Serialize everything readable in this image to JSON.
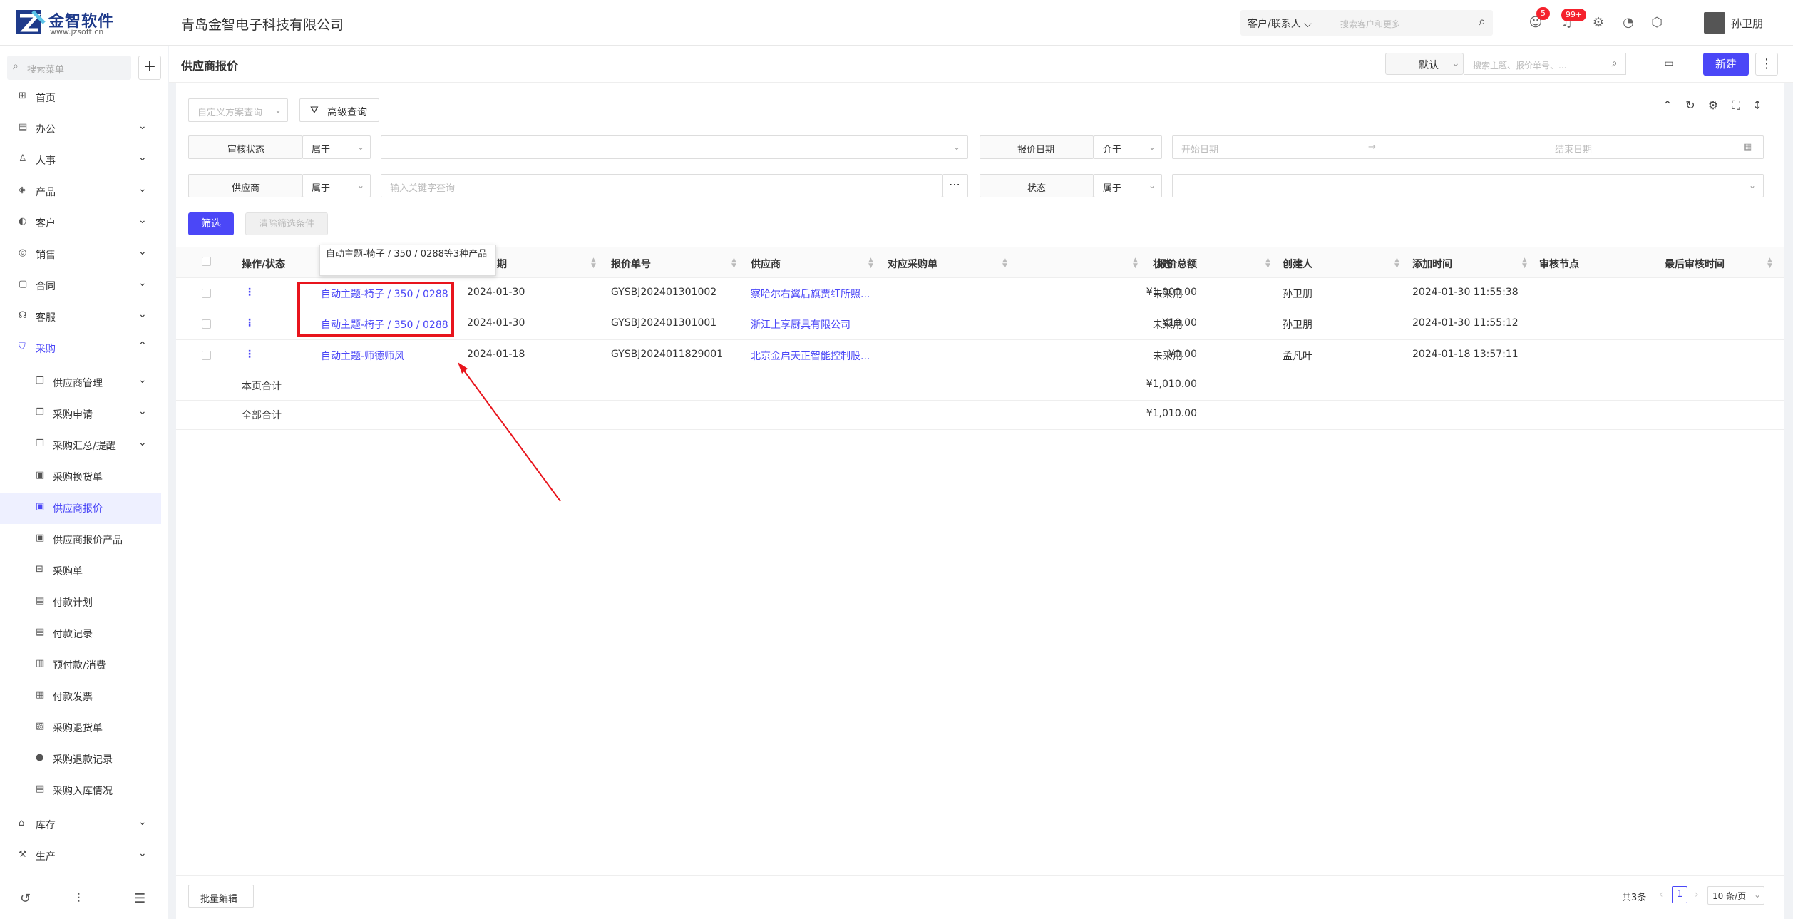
{
  "topbar": {
    "logo_text": "金智软件",
    "logo_sub": "www.jzsoft.cn",
    "company": "青岛金智电子科技有限公司",
    "search_select": "客户/联系人",
    "search_placeholder": "搜索客户和更多",
    "badge_messages": "5",
    "badge_notifications": "99+",
    "user_name": "孙卫朋"
  },
  "sidebar": {
    "search_placeholder": "搜索菜单",
    "items": [
      {
        "label": "首页",
        "icon": "home-icon"
      },
      {
        "label": "办公",
        "icon": "office-icon"
      },
      {
        "label": "人事",
        "icon": "people-icon"
      },
      {
        "label": "产品",
        "icon": "product-icon"
      },
      {
        "label": "客户",
        "icon": "customer-icon"
      },
      {
        "label": "销售",
        "icon": "sales-icon"
      },
      {
        "label": "合同",
        "icon": "contract-icon"
      },
      {
        "label": "客服",
        "icon": "service-icon"
      },
      {
        "label": "采购",
        "icon": "purchase-icon"
      }
    ],
    "sub_items": [
      {
        "label": "供应商管理"
      },
      {
        "label": "采购申请"
      },
      {
        "label": "采购汇总/提醒"
      },
      {
        "label": "采购换货单"
      },
      {
        "label": "供应商报价"
      },
      {
        "label": "供应商报价产品"
      },
      {
        "label": "采购单"
      },
      {
        "label": "付款计划"
      },
      {
        "label": "付款记录"
      },
      {
        "label": "预付款/消费"
      },
      {
        "label": "付款发票"
      },
      {
        "label": "采购退货单"
      },
      {
        "label": "采购退款记录"
      },
      {
        "label": "采购入库情况"
      }
    ],
    "bottom_items": [
      {
        "label": "库存"
      },
      {
        "label": "生产"
      }
    ]
  },
  "page": {
    "title": "供应商报价",
    "view_select": "默认",
    "search_placeholder": "搜索主题、报价单号、...",
    "new_button": "新建"
  },
  "filters": {
    "custom_query": "自定义方案查询",
    "advanced": "高级查询",
    "row1": {
      "field1": "审核状态",
      "op1": "属于",
      "field2": "报价日期",
      "op2": "介于",
      "start": "开始日期",
      "end": "结束日期",
      "sep": "→"
    },
    "row2": {
      "field1": "供应商",
      "op1": "属于",
      "placeholder": "输入关键字查询",
      "field2": "状态",
      "op2": "属于"
    },
    "filter_btn": "筛选",
    "clear_btn": "清除筛选条件"
  },
  "table": {
    "headers": [
      "操作/状态",
      "主题",
      "报价日期",
      "报价单号",
      "供应商",
      "对应采购单",
      "报价总额",
      "状态",
      "创建人",
      "添加时间",
      "审核节点",
      "最后审核时间"
    ],
    "rows": [
      {
        "subject": "自动主题-椅子 / 350 / 0288...",
        "date": "2024-01-30",
        "no": "GYSBJ202401301002",
        "supplier": "察哈尔右翼后旗贾红所照...",
        "po": "",
        "total": "¥1,000.00",
        "status": "未采用",
        "creator": "孙卫朋",
        "time": "2024-01-30 11:55:38"
      },
      {
        "subject": "自动主题-椅子 / 350 / 0288...",
        "date": "2024-01-30",
        "no": "GYSBJ202401301001",
        "supplier": "浙江上享厨具有限公司",
        "po": "",
        "total": "¥10.00",
        "status": "未采用",
        "creator": "孙卫朋",
        "time": "2024-01-30 11:55:12"
      },
      {
        "subject": "自动主题-师德师风",
        "date": "2024-01-18",
        "no": "GYSBJ2024011829001",
        "supplier": "北京金启天正智能控制股...",
        "po": "",
        "total": "¥0.00",
        "status": "未采用",
        "creator": "孟凡叶",
        "time": "2024-01-18 13:57:11"
      }
    ],
    "page_total_label": "本页合计",
    "page_total": "¥1,010.00",
    "all_total_label": "全部合计",
    "all_total": "¥1,010.00",
    "tooltip": "自动主题-椅子 / 350 / 0288等3种产品"
  },
  "footer": {
    "batch_edit": "批量编辑",
    "count": "共3条",
    "current_page": "1",
    "page_size": "10 条/页"
  },
  "colors": {
    "accent": "#4b47f7",
    "highlight": "#e8141c"
  }
}
